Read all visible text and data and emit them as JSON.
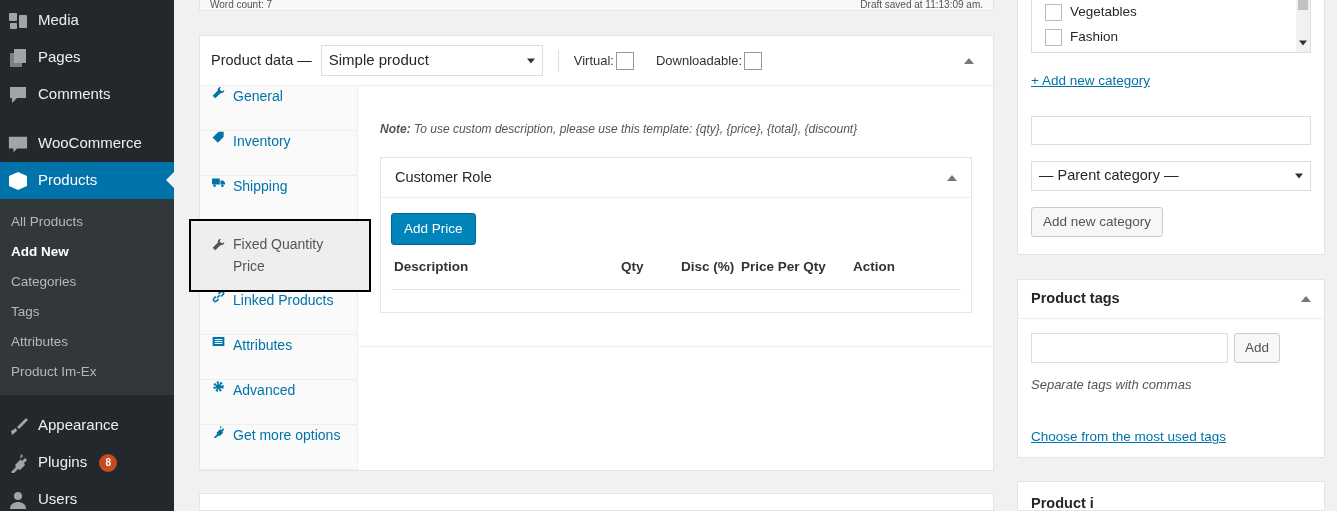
{
  "sidebar": {
    "sections": [
      {
        "items": [
          {
            "label": "Media",
            "selected": false
          },
          {
            "label": "Pages",
            "selected": false
          },
          {
            "label": "Comments",
            "selected": false
          }
        ]
      },
      {
        "items": [
          {
            "label": "WooCommerce",
            "selected": false
          },
          {
            "label": "Products",
            "selected": true,
            "children": [
              {
                "label": "All Products",
                "selected": false
              },
              {
                "label": "Add New",
                "selected": true
              },
              {
                "label": "Categories",
                "selected": false
              },
              {
                "label": "Tags",
                "selected": false
              },
              {
                "label": "Attributes",
                "selected": false
              },
              {
                "label": "Product Im-Ex",
                "selected": false
              }
            ]
          }
        ]
      },
      {
        "items": [
          {
            "label": "Appearance",
            "selected": false
          },
          {
            "label": "Plugins",
            "selected": false,
            "badge": "8"
          },
          {
            "label": "Users",
            "selected": false
          }
        ]
      }
    ]
  },
  "editor_status": {
    "word_count": "Word count: 7",
    "draft_status": "Draft saved at 11:13:09 am."
  },
  "product_data": {
    "title": "Product data —",
    "product_type": "Simple product",
    "virtual": {
      "label": "Virtual:",
      "checked": false
    },
    "downloadable": {
      "label": "Downloadable:",
      "checked": false
    },
    "tabs": [
      {
        "label": "General",
        "selected": false
      },
      {
        "label": "Inventory",
        "selected": false
      },
      {
        "label": "Shipping",
        "selected": false
      },
      {
        "label": "Fixed Quantity Price",
        "selected": true
      },
      {
        "label": "Linked Products",
        "selected": false
      },
      {
        "label": "Attributes",
        "selected": false
      },
      {
        "label": "Advanced",
        "selected": false
      },
      {
        "label": "Get more options",
        "selected": false
      }
    ],
    "note": "**Note:** To use custom description, please use this template: {qty}, {price}, {total}, {discount}",
    "customer_role": {
      "title": "Customer Role",
      "add_button": "Add Price",
      "columns": [
        "Description",
        "Qty",
        "Disc (%)",
        "Price Per Qty",
        "Action"
      ]
    }
  },
  "categories": {
    "items": [
      {
        "label": "Vegetables",
        "checked": false
      },
      {
        "label": "Fashion",
        "checked": false
      }
    ],
    "add_link": "+ Add new category",
    "parent_select": "— Parent category —",
    "add_button": "Add new category"
  },
  "product_tags": {
    "title": "Product tags",
    "add_button": "Add",
    "hint": "Separate tags with commas",
    "link": "Choose from the most used tags"
  },
  "next_panel": {
    "title": "Product i"
  }
}
